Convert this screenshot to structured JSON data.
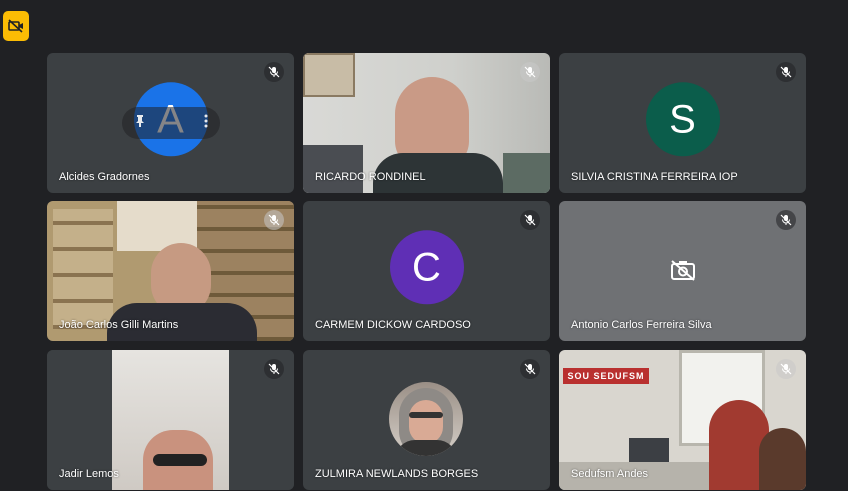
{
  "meeting": {
    "camera_button_icon": "camera-off-icon",
    "participants": [
      {
        "name": "Alcides Gradornes",
        "avatar_letter": "A",
        "avatar_color": "#1a73e8"
      },
      {
        "name": "RICARDO RONDINEL"
      },
      {
        "name": "SILVIA CRISTINA FERREIRA IOP",
        "avatar_letter": "S",
        "avatar_color": "#0b5d4b"
      },
      {
        "name": "João Carlos Gilli Martins"
      },
      {
        "name": "CARMEM DICKOW CARDOSO",
        "avatar_letter": "C",
        "avatar_color": "#5f2fb5"
      },
      {
        "name": "Antonio Carlos Ferreira Silva"
      },
      {
        "name": "Jadir Lemos"
      },
      {
        "name": "ZULMIRA NEWLANDS BORGES"
      },
      {
        "name": "Sedufsm Andes",
        "sign_text": "SOU SEDUFSM"
      }
    ]
  }
}
